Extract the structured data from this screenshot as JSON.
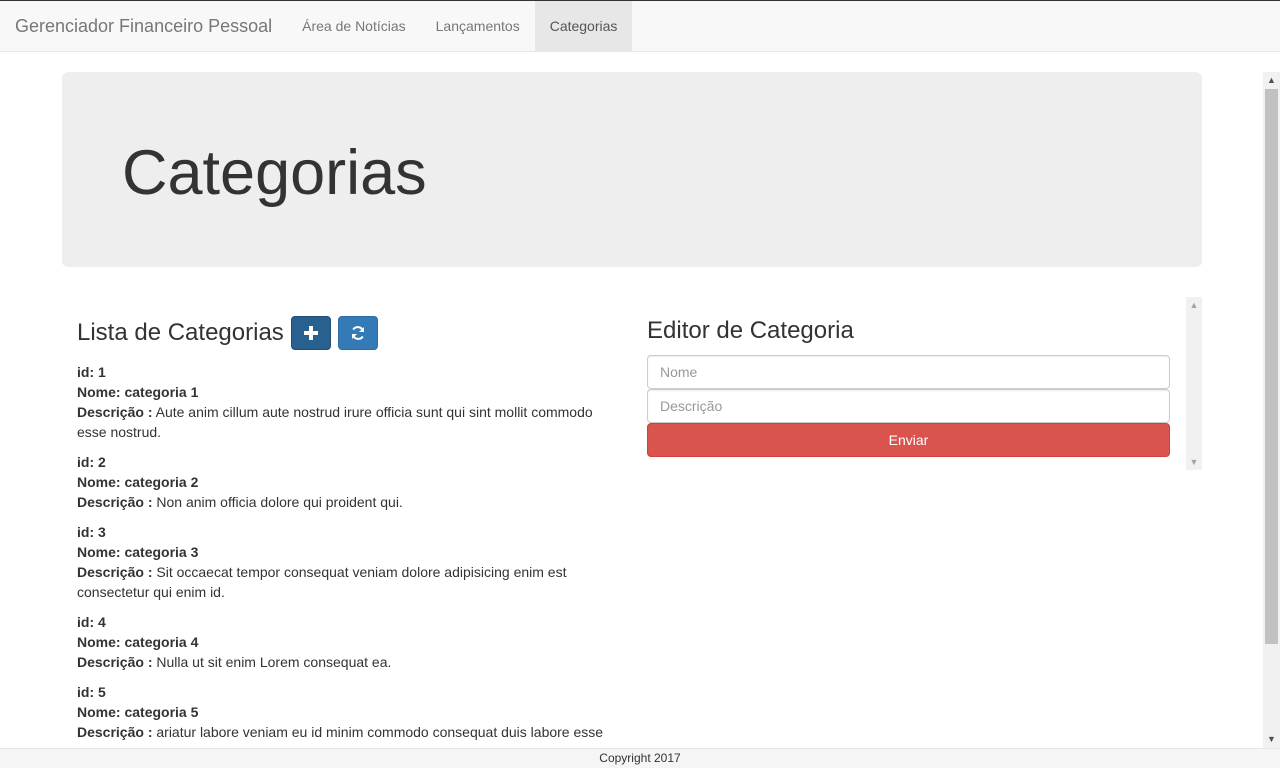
{
  "navbar": {
    "brand": "Gerenciador Financeiro Pessoal",
    "items": [
      {
        "label": "Área de Notícias"
      },
      {
        "label": "Lançamentos"
      },
      {
        "label": "Categorias",
        "active": true
      }
    ]
  },
  "jumbotron": {
    "title": "Categorias"
  },
  "list": {
    "title": "Lista de Categorias",
    "add_icon": "plus-icon",
    "refresh_icon": "refresh-icon",
    "id_label": "id:",
    "name_label": "Nome:",
    "desc_label": "Descrição :",
    "items": [
      {
        "id": "1",
        "nome": "categoria 1",
        "descricao": "Aute anim cillum aute nostrud irure officia sunt qui sint mollit commodo esse nostrud."
      },
      {
        "id": "2",
        "nome": "categoria 2",
        "descricao": "Non anim officia dolore qui proident qui."
      },
      {
        "id": "3",
        "nome": "categoria 3",
        "descricao": "Sit occaecat tempor consequat veniam dolore adipisicing enim est consectetur qui enim id."
      },
      {
        "id": "4",
        "nome": "categoria 4",
        "descricao": "Nulla ut sit enim Lorem consequat ea."
      },
      {
        "id": "5",
        "nome": "categoria 5",
        "descricao": "ariatur labore veniam eu id minim commodo consequat duis labore esse"
      }
    ]
  },
  "editor": {
    "title": "Editor de Categoria",
    "nome_placeholder": "Nome",
    "descricao_placeholder": "Descrição",
    "submit_label": "Enviar"
  },
  "footer": {
    "text": "Copyright 2017"
  },
  "colors": {
    "primary": "#337ab7",
    "danger": "#d9534f",
    "jumbotron": "#eeeeee"
  }
}
